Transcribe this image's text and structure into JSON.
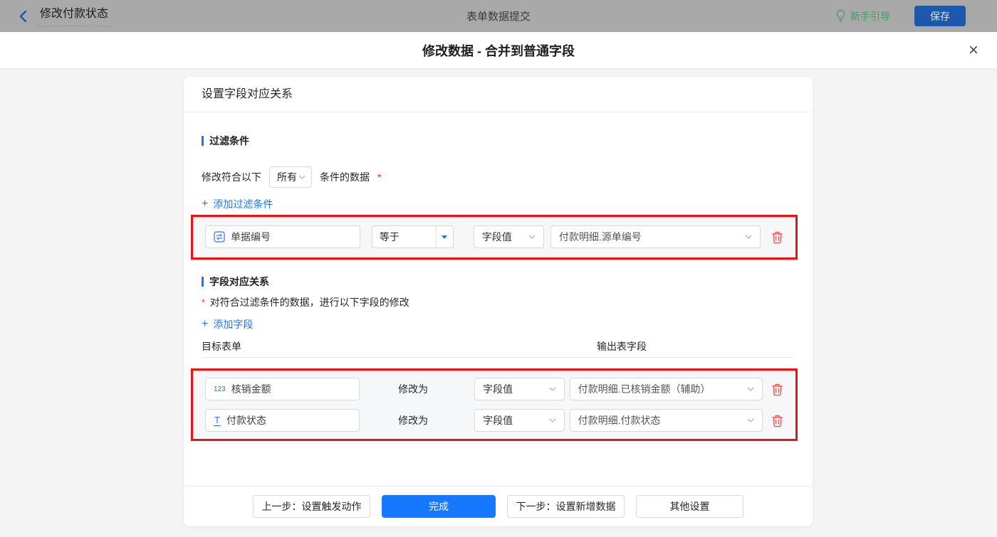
{
  "topbar": {
    "back_title": "修改付款状态",
    "center_title": "表单数据提交",
    "guide_label": "新手引导",
    "save_label": "保存"
  },
  "dialog": {
    "title": "修改数据 - 合并到普通字段"
  },
  "panel": {
    "title": "设置字段对应关系",
    "filter": {
      "section_title": "过滤条件",
      "mode_prefix": "修改符合以下",
      "mode_value": "所有",
      "mode_suffix": "条件的数据",
      "required_mark": "*",
      "add_label": "添加过滤条件",
      "row": {
        "field": "单据编号",
        "operator": "等于",
        "value_type": "字段值",
        "value": "付款明细.源单编号"
      }
    },
    "mapping": {
      "section_title": "字段对应关系",
      "required_mark": "*",
      "note": "对符合过滤条件的数据，进行以下字段的修改",
      "add_label": "添加字段",
      "columns": {
        "target": "目标表单",
        "output": "输出表字段"
      },
      "rows": [
        {
          "icon_text": "123",
          "field": "核销金额",
          "modify": "修改为",
          "value_type": "字段值",
          "value": "付款明细.已核销金额（辅助）"
        },
        {
          "icon_text": "T",
          "field": "付款状态",
          "modify": "修改为",
          "value_type": "字段值",
          "value": "付款明细.付款状态"
        }
      ]
    },
    "footer": {
      "prev": "上一步：设置触发动作",
      "done": "完成",
      "next": "下一步：设置新增数据",
      "other": "其他设置"
    }
  },
  "icons": {
    "plus": "+",
    "close": "×"
  },
  "colors": {
    "accent_blue": "#1677ff",
    "annotation_red": "#ee1111",
    "danger_red": "#f54a45",
    "guide_green": "#3da15c"
  }
}
